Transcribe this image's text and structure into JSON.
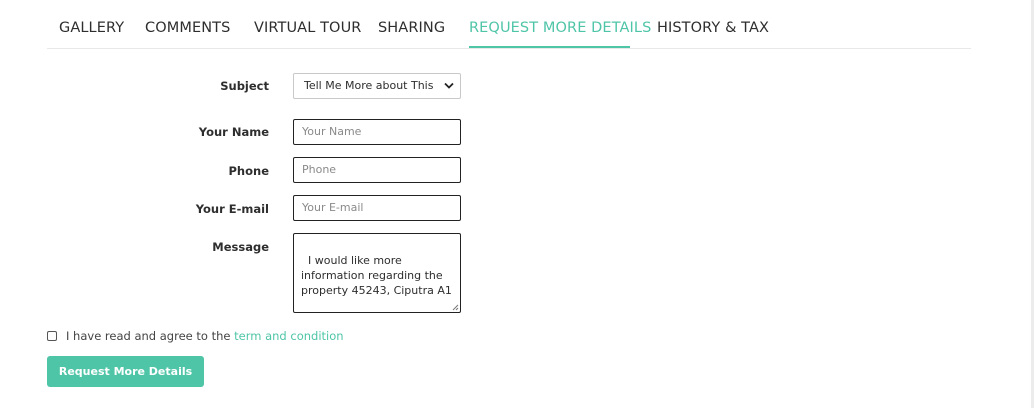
{
  "tabs": [
    {
      "label": "GALLERY"
    },
    {
      "label": "COMMENTS"
    },
    {
      "label": "VIRTUAL TOUR"
    },
    {
      "label": "SHARING"
    },
    {
      "label": "REQUEST MORE DETAILS",
      "active": true
    },
    {
      "label": "HISTORY & TAX"
    }
  ],
  "form": {
    "subject_label": "Subject",
    "subject_value": "Tell Me More about This",
    "name_label": "Your Name",
    "name_placeholder": "Your Name",
    "phone_label": "Phone",
    "phone_placeholder": "Phone",
    "email_label": "Your E-mail",
    "email_placeholder": "Your E-mail",
    "message_label": "Message",
    "message_value": "I would like more information regarding the property 45243, Ciputra A1"
  },
  "agree": {
    "text": "I have read and agree to the ",
    "link": "term and condition",
    "checked": false
  },
  "submit_label": "Request More Details",
  "colors": {
    "accent": "#4fc5a8",
    "text": "#2e2e2e"
  }
}
